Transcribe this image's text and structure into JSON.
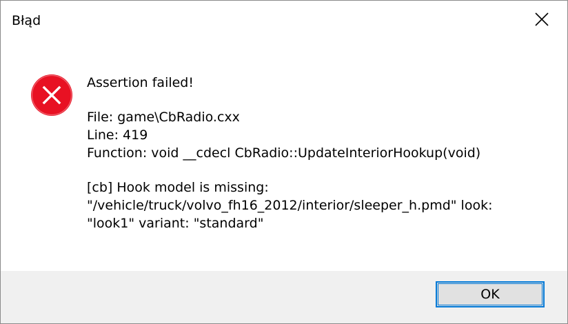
{
  "window": {
    "title": "Błąd",
    "close_icon": "close-icon"
  },
  "message": {
    "icon": "error-icon",
    "heading": "Assertion failed!",
    "file_line": "File: game\\CbRadio.cxx",
    "line_line": "Line: 419",
    "function_line": "Function: void __cdecl CbRadio::UpdateInteriorHookup(void)",
    "detail_line1": "[cb] Hook model is missing:",
    "detail_line2": "\"/vehicle/truck/volvo_fh16_2012/interior/sleeper_h.pmd\" look:",
    "detail_line3": "\"look1\" variant: \"standard\""
  },
  "footer": {
    "ok_label": "OK"
  },
  "colors": {
    "error_red": "#e81123",
    "accent_blue": "#0078d7",
    "footer_bg": "#f0f0f0"
  }
}
